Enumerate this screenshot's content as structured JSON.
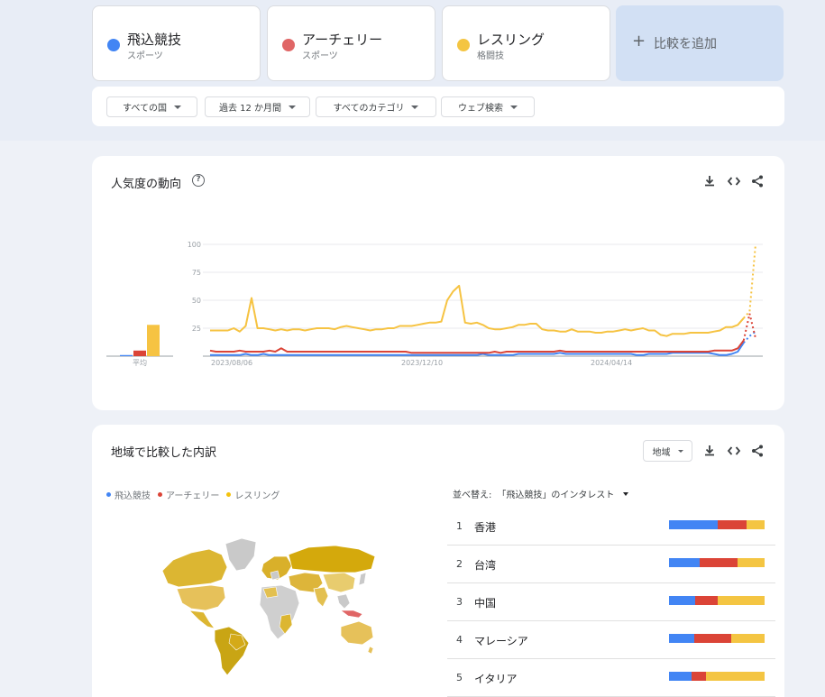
{
  "colors": {
    "blue": "#4285f4",
    "red": "#db4437",
    "yellow": "#f4c20d",
    "yellow_line": "#f6c342"
  },
  "terms": [
    {
      "name": "飛込競技",
      "category": "スポーツ",
      "color": "#4285f4"
    },
    {
      "name": "アーチェリー",
      "category": "スポーツ",
      "color": "#e06666"
    },
    {
      "name": "レスリング",
      "category": "格闘技",
      "color": "#f4c542"
    }
  ],
  "add_compare": {
    "icon": "plus-icon",
    "label": "比較を追加"
  },
  "filters": [
    {
      "label": "すべての国"
    },
    {
      "label": "過去 12 か月間"
    },
    {
      "label": "すべてのカテゴリ"
    },
    {
      "label": "ウェブ検索"
    }
  ],
  "interest_over_time": {
    "title": "人気度の動向",
    "actions": [
      "download-icon",
      "embed-icon",
      "share-icon"
    ]
  },
  "chart_data": {
    "type": "line",
    "average_label": "平均",
    "average_values": {
      "飛込競技": 1,
      "アーチェリー": 5,
      "レスリング": 28
    },
    "y_ticks": [
      100,
      75,
      50,
      25
    ],
    "ylim": [
      0,
      100
    ],
    "x_tick_labels": [
      "2023/08/06",
      "2023/12/10",
      "2024/04/14"
    ],
    "series": [
      {
        "name": "飛込競技",
        "values": [
          1,
          1,
          1,
          1,
          1,
          1,
          2,
          1,
          1,
          2,
          1,
          1,
          1,
          1,
          1,
          1,
          1,
          1,
          1,
          1,
          1,
          1,
          1,
          1,
          1,
          1,
          1,
          1,
          1,
          1,
          1,
          1,
          1,
          1,
          1,
          1,
          1,
          1,
          1,
          1,
          1,
          1,
          1,
          1,
          1,
          1,
          2,
          1,
          1,
          1,
          1,
          1,
          2,
          2,
          2,
          2,
          2,
          2,
          2,
          3,
          2,
          2,
          2,
          2,
          2,
          2,
          2,
          2,
          2,
          2,
          2,
          2,
          1,
          1,
          2,
          2,
          2,
          2,
          3,
          3,
          3,
          3,
          3,
          3,
          3,
          2,
          1,
          1,
          2,
          4,
          12,
          18,
          22
        ]
      },
      {
        "name": "アーチェリー",
        "values": [
          5,
          4,
          4,
          4,
          4,
          5,
          4,
          4,
          4,
          4,
          5,
          4,
          7,
          4,
          4,
          4,
          4,
          4,
          4,
          4,
          4,
          4,
          4,
          4,
          4,
          4,
          4,
          4,
          4,
          4,
          4,
          4,
          4,
          4,
          3,
          3,
          3,
          3,
          3,
          3,
          3,
          3,
          3,
          3,
          3,
          3,
          3,
          3,
          4,
          3,
          4,
          4,
          4,
          4,
          4,
          4,
          4,
          4,
          4,
          5,
          4,
          4,
          4,
          4,
          4,
          4,
          4,
          4,
          4,
          4,
          4,
          4,
          4,
          4,
          4,
          4,
          4,
          4,
          4,
          4,
          4,
          4,
          4,
          4,
          4,
          5,
          5,
          5,
          5,
          7,
          14,
          38,
          16
        ]
      },
      {
        "name": "レスリング",
        "values": [
          23,
          23,
          23,
          23,
          25,
          22,
          27,
          52,
          25,
          25,
          24,
          23,
          24,
          23,
          24,
          24,
          23,
          24,
          25,
          25,
          25,
          24,
          26,
          27,
          26,
          25,
          24,
          23,
          24,
          24,
          25,
          25,
          27,
          27,
          27,
          28,
          29,
          30,
          30,
          31,
          50,
          58,
          63,
          30,
          29,
          30,
          28,
          25,
          24,
          24,
          25,
          26,
          28,
          28,
          29,
          29,
          24,
          23,
          23,
          22,
          22,
          24,
          22,
          22,
          22,
          21,
          21,
          22,
          22,
          23,
          24,
          23,
          24,
          25,
          23,
          23,
          19,
          18,
          20,
          20,
          20,
          21,
          21,
          21,
          21,
          22,
          23,
          26,
          26,
          28,
          34,
          40,
          100
        ]
      }
    ]
  },
  "region": {
    "title": "地域で比較した内訳",
    "select": "地域",
    "actions": [
      "download-icon",
      "embed-icon",
      "share-icon"
    ],
    "legend": [
      "飛込競技",
      "アーチェリー",
      "レスリング"
    ],
    "sort_label": "並べ替え:",
    "sort_value": "「飛込競技」のインタレスト",
    "rows": [
      {
        "rank": "1",
        "name": "香港",
        "shares": [
          51,
          30,
          19
        ]
      },
      {
        "rank": "2",
        "name": "台湾",
        "shares": [
          32,
          40,
          28
        ]
      },
      {
        "rank": "3",
        "name": "中国",
        "shares": [
          27,
          24,
          49
        ]
      },
      {
        "rank": "4",
        "name": "マレーシア",
        "shares": [
          26,
          39,
          35
        ]
      },
      {
        "rank": "5",
        "name": "イタリア",
        "shares": [
          24,
          15,
          61
        ]
      }
    ]
  }
}
